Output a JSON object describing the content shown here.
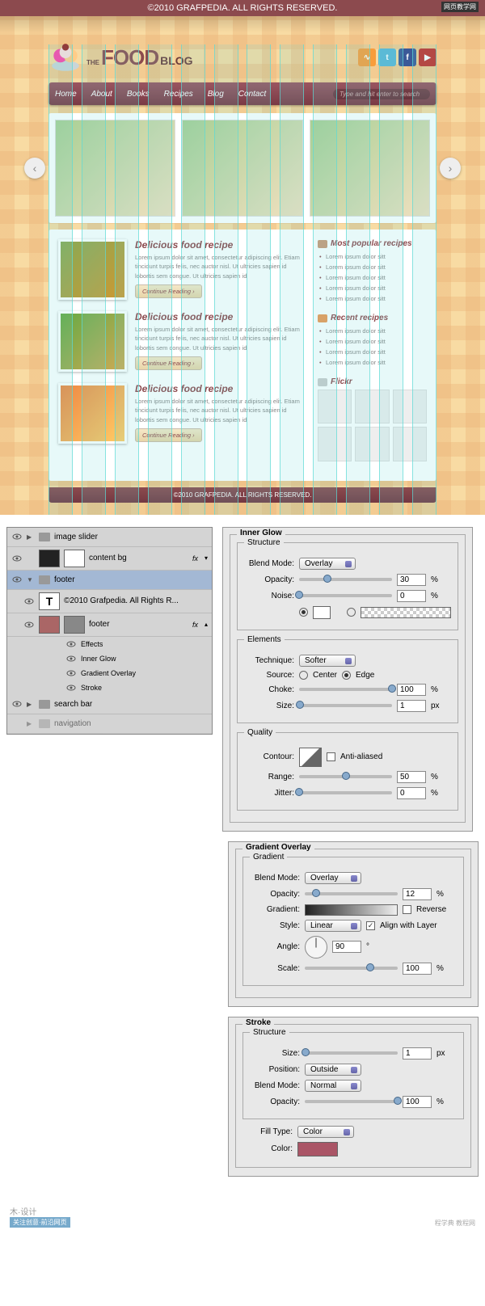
{
  "topbar": {
    "copyright": "©2010 GRAFPEDIA. ALL RIGHTS RESERVED.",
    "watermark": "网页教学网"
  },
  "logo": {
    "the": "THE",
    "food": "FOOD",
    "blog": "BLOG"
  },
  "nav": [
    "Home",
    "About",
    "Books",
    "Recipes",
    "Blog",
    "Contact"
  ],
  "search": {
    "placeholder": "Type and hit enter to search"
  },
  "post": {
    "title": "Delicious food recipe",
    "text": "Lorem ipsum dolor sit amet, consectetur adipiscing elit. Etiam tincidunt turpis felis, nec auctor nisl. Ut ultricies sapien id lobortis sem congue. Ut ultricies sapien id",
    "button": "Continue Reading ›"
  },
  "sidebar": {
    "popular": {
      "title": "Most popular recipes",
      "items": [
        "Lorem ipsum dolor sitt",
        "Lorem ipsum dolor sitt",
        "Lorem ipsum dolor sitt",
        "Lorem ipsum dolor sitt",
        "Lorem ipsum dolor sitt"
      ]
    },
    "recent": {
      "title": "Recent recipes",
      "items": [
        "Lorem ipsum dolor sitt",
        "Lorem ipsum dolor sitt",
        "Lorem ipsum dolor sitt",
        "Lorem ipsum dolor sitt"
      ]
    },
    "flickr": {
      "title": "Flickr"
    }
  },
  "footer": {
    "copyright": "©2010 GRAFPEDIA. ALL RIGHTS RESERVED."
  },
  "layers": {
    "l1": "image slider",
    "l2": "content bg",
    "l3": "footer",
    "l4": "©2010 Grafpedia. All Rights R...",
    "l5": "footer",
    "fx_label": "Effects",
    "fx1": "Inner Glow",
    "fx2": "Gradient Overlay",
    "fx3": "Stroke",
    "l6": "search bar",
    "l7": "navigation",
    "fx": "fx"
  },
  "innerglow": {
    "title": "Inner Glow",
    "structure": "Structure",
    "elements": "Elements",
    "quality": "Quality",
    "blend_mode": "Blend Mode:",
    "blend_val": "Overlay",
    "opacity": "Opacity:",
    "opacity_val": "30",
    "pct": "%",
    "noise": "Noise:",
    "noise_val": "0",
    "technique": "Technique:",
    "technique_val": "Softer",
    "source": "Source:",
    "center": "Center",
    "edge": "Edge",
    "choke": "Choke:",
    "choke_val": "100",
    "size": "Size:",
    "size_val": "1",
    "px": "px",
    "contour": "Contour:",
    "anti": "Anti-aliased",
    "range": "Range:",
    "range_val": "50",
    "jitter": "Jitter:",
    "jitter_val": "0"
  },
  "gradov": {
    "title": "Gradient Overlay",
    "gradient_leg": "Gradient",
    "blend_mode": "Blend Mode:",
    "blend_val": "Overlay",
    "opacity": "Opacity:",
    "opacity_val": "12",
    "gradient": "Gradient:",
    "reverse": "Reverse",
    "style": "Style:",
    "style_val": "Linear",
    "align": "Align with Layer",
    "angle": "Angle:",
    "angle_val": "90",
    "scale": "Scale:",
    "scale_val": "100"
  },
  "stroke": {
    "title": "Stroke",
    "structure": "Structure",
    "size": "Size:",
    "size_val": "1",
    "px": "px",
    "position": "Position:",
    "position_val": "Outside",
    "blend_mode": "Blend Mode:",
    "blend_val": "Normal",
    "opacity": "Opacity:",
    "opacity_val": "100",
    "fill_type": "Fill Type:",
    "fill_val": "Color",
    "color": "Color:"
  },
  "marks": {
    "left": "木·设计",
    "left2": "关注创意·前沿网页",
    "right": "程学典 教程网"
  }
}
